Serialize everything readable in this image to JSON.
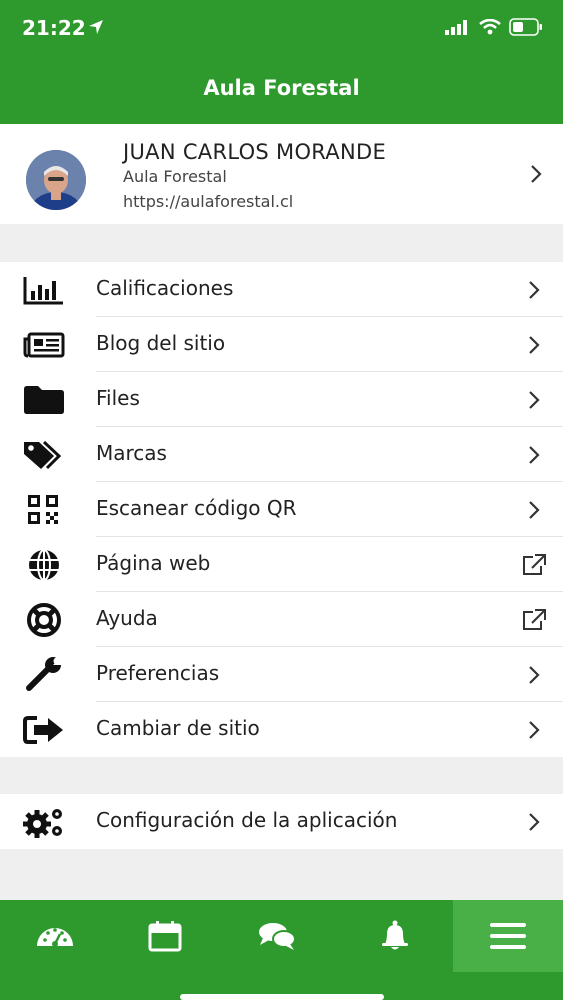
{
  "status": {
    "time": "21:22"
  },
  "header": {
    "title": "Aula Forestal"
  },
  "profile": {
    "name": "JUAN CARLOS MORANDE",
    "site": "Aula Forestal",
    "url": "https://aulaforestal.cl"
  },
  "menu": {
    "items": [
      {
        "label": "Calificaciones",
        "icon": "bar-chart-icon",
        "trail": "chevron"
      },
      {
        "label": "Blog del sitio",
        "icon": "newspaper-icon",
        "trail": "chevron"
      },
      {
        "label": "Files",
        "icon": "folder-icon",
        "trail": "chevron"
      },
      {
        "label": "Marcas",
        "icon": "tags-icon",
        "trail": "chevron"
      },
      {
        "label": "Escanear código QR",
        "icon": "qr-code-icon",
        "trail": "chevron"
      },
      {
        "label": "Página web",
        "icon": "globe-icon",
        "trail": "external-link"
      },
      {
        "label": "Ayuda",
        "icon": "life-ring-icon",
        "trail": "external-link"
      },
      {
        "label": "Preferencias",
        "icon": "wrench-icon",
        "trail": "chevron"
      },
      {
        "label": "Cambiar de sitio",
        "icon": "sign-out-icon",
        "trail": "chevron"
      }
    ]
  },
  "app_settings": {
    "label": "Configuración de la aplicación",
    "icon": "gears-icon"
  },
  "tabs": [
    "dashboard-icon",
    "calendar-icon",
    "messages-icon",
    "notifications-icon",
    "menu-icon"
  ],
  "colors": {
    "brand": "#2e9a2d",
    "active_tab": "#49b048",
    "background": "#efefef"
  }
}
